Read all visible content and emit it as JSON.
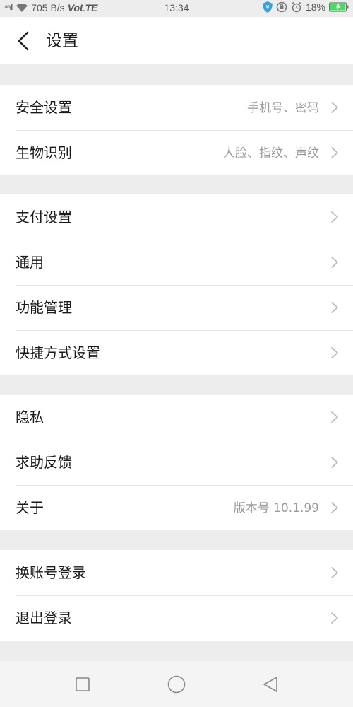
{
  "status_bar": {
    "signal_text": "⁴⁶ıll",
    "speed": "705 B/s",
    "network": "VoLTE",
    "time": "13:34",
    "battery_percent": "18%",
    "icons": [
      "wifi-icon",
      "shield-icon",
      "lock-rotation-icon",
      "alarm-icon",
      "battery-icon"
    ]
  },
  "header": {
    "back_icon": "chevron-left-icon",
    "title": "设置"
  },
  "groups": [
    {
      "items": [
        {
          "label": "安全设置",
          "value": "手机号、密码"
        },
        {
          "label": "生物识别",
          "value": "人脸、指纹、声纹"
        }
      ]
    },
    {
      "items": [
        {
          "label": "支付设置",
          "value": ""
        },
        {
          "label": "通用",
          "value": ""
        },
        {
          "label": "功能管理",
          "value": ""
        },
        {
          "label": "快捷方式设置",
          "value": ""
        }
      ]
    },
    {
      "items": [
        {
          "label": "隐私",
          "value": ""
        },
        {
          "label": "求助反馈",
          "value": ""
        },
        {
          "label": "关于",
          "value": "版本号 10.1.99"
        }
      ]
    },
    {
      "items": [
        {
          "label": "换账号登录",
          "value": ""
        },
        {
          "label": "退出登录",
          "value": ""
        }
      ]
    }
  ],
  "nav_bar": {
    "buttons": [
      "recents-square-icon",
      "home-circle-icon",
      "back-triangle-icon"
    ]
  },
  "colors": {
    "background": "#ededed",
    "surface": "#ffffff",
    "text_primary": "#1a1a1a",
    "text_secondary": "#9a9a9a",
    "divider": "#e5e5e5",
    "battery_green": "#4cd964"
  }
}
